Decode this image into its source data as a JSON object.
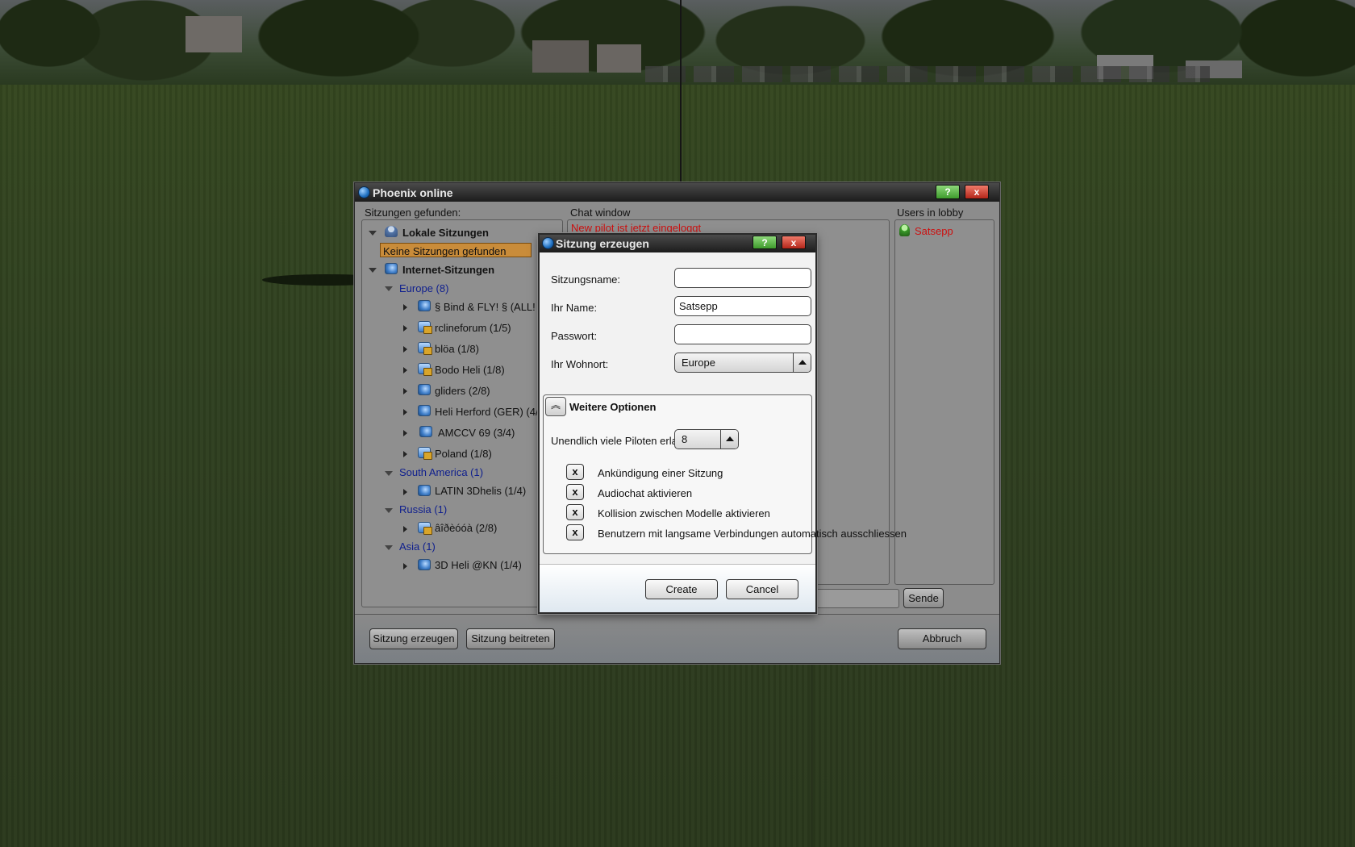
{
  "main_window": {
    "title": "Phoenix online",
    "help_label": "?",
    "close_label": "x",
    "sessions_label": "Sitzungen gefunden:",
    "chat_label": "Chat window",
    "lobby_label": "Users in lobby",
    "chat_message": "New pilot ist jetzt eingeloggt",
    "lobby_users": [
      "Satsepp"
    ],
    "send_label": "Sende",
    "create_session_label": "Sitzung erzeugen",
    "join_session_label": "Sitzung beitreten",
    "abort_label": "Abbruch"
  },
  "tree": {
    "local_label": "Lokale Sitzungen",
    "local_empty": "Keine Sitzungen gefunden",
    "internet_label": "Internet-Sitzungen",
    "groups": [
      {
        "label": "Europe (8)",
        "items": [
          "§ Bind & FLY! § (ALL!",
          "rclineforum (1/5)",
          "blöa (1/8)",
          "Bodo Heli (1/8)",
          "gliders (2/8)",
          "Heli Herford (GER) (4/",
          "AMCCV 69 (3/4)",
          "Poland (1/8)"
        ]
      },
      {
        "label": "South America (1)",
        "items": [
          "LATIN 3Dhelis (1/4)"
        ]
      },
      {
        "label": "Russia (1)",
        "items": [
          "âîðèóóà (2/8)"
        ]
      },
      {
        "label": "Asia (1)",
        "items": [
          "3D Heli @KN (1/4)"
        ]
      }
    ]
  },
  "dialog": {
    "title": "Sitzung erzeugen",
    "help_label": "?",
    "close_label": "x",
    "session_name_label": "Sitzungsname:",
    "session_name_value": "",
    "your_name_label": "Ihr Name:",
    "your_name_value": "Satsepp",
    "password_label": "Passwort:",
    "password_value": "",
    "residence_label": "Ihr Wohnort:",
    "residence_value": "Europe",
    "more_options_label": "Weitere Optionen",
    "pilots_label": "Unendlich viele Piloten erla",
    "pilots_value": "8",
    "options": [
      {
        "label": "Ankündigung einer Sitzung",
        "mark": "x"
      },
      {
        "label": "Audiochat aktivieren",
        "mark": "x"
      },
      {
        "label": "Kollision zwischen Modelle aktivieren",
        "mark": "x"
      },
      {
        "label": "Benutzern mit langsame Verbindungen automatisch ausschliessen",
        "mark": "x"
      }
    ],
    "create_label": "Create",
    "cancel_label": "Cancel"
  },
  "colors": {
    "group_link": "#10208e",
    "chat_red": "#cc1111",
    "selection": "#c98c3a"
  }
}
